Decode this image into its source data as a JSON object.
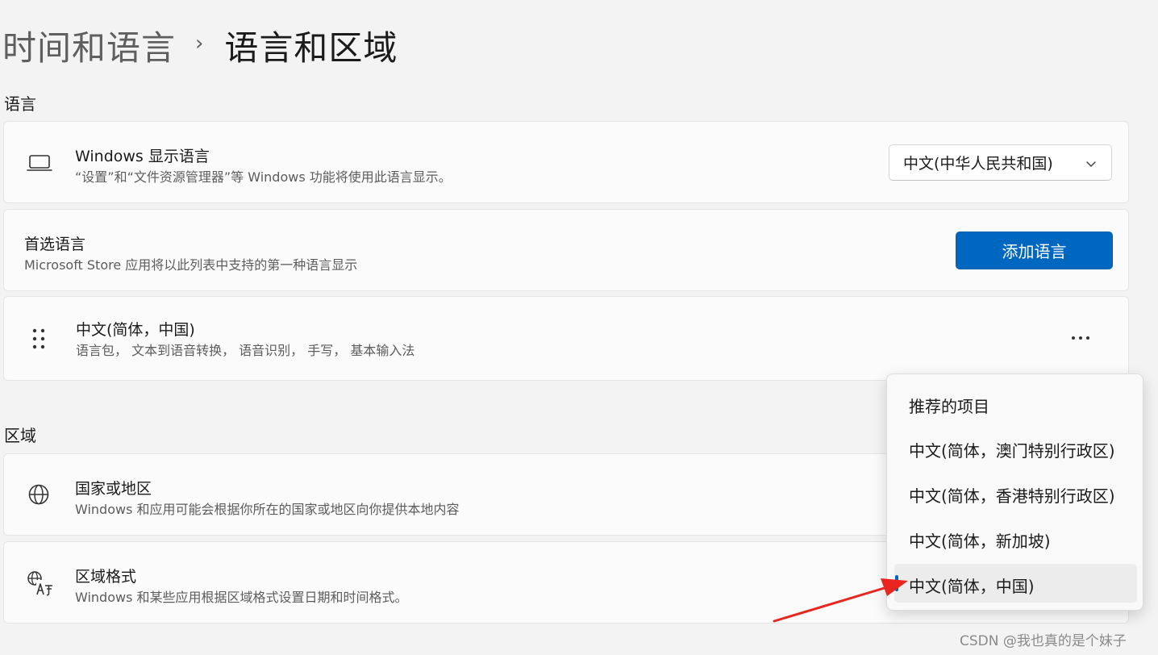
{
  "breadcrumb": {
    "parent": "时间和语言",
    "separator": "›",
    "current": "语言和区域"
  },
  "sections": {
    "language": "语言",
    "region": "区域"
  },
  "display_language": {
    "icon": "laptop-icon",
    "title": "Windows 显示语言",
    "description": "“设置”和“文件资源管理器”等 Windows 功能将使用此语言显示。",
    "dropdown_value": "中文(中华人民共和国)"
  },
  "preferred_language": {
    "title": "首选语言",
    "description": "Microsoft Store 应用将以此列表中支持的第一种语言显示",
    "add_button": "添加语言"
  },
  "language_item": {
    "icon": "drag-handle-icon",
    "title": "中文(简体，中国)",
    "description": "语言包， 文本到语音转换， 语音识别， 手写， 基本输入法"
  },
  "country_region": {
    "icon": "globe-icon",
    "title": "国家或地区",
    "description": "Windows 和应用可能会根据你所在的国家或地区向你提供本地内容"
  },
  "regional_format": {
    "icon": "language-format-icon",
    "title": "区域格式",
    "description": "Windows 和某些应用根据区域格式设置日期和时间格式。"
  },
  "dropdown_menu": {
    "items": [
      "推荐的项目",
      "中文(简体，澳门特别行政区)",
      "中文(简体，香港特别行政区)",
      "中文(简体，新加坡)",
      "中文(简体，中国)"
    ],
    "selected_index": 4
  },
  "watermark": "CSDN @我也真的是个妹子",
  "colors": {
    "accent": "#0067c0",
    "annotation_arrow": "#e8261f"
  }
}
